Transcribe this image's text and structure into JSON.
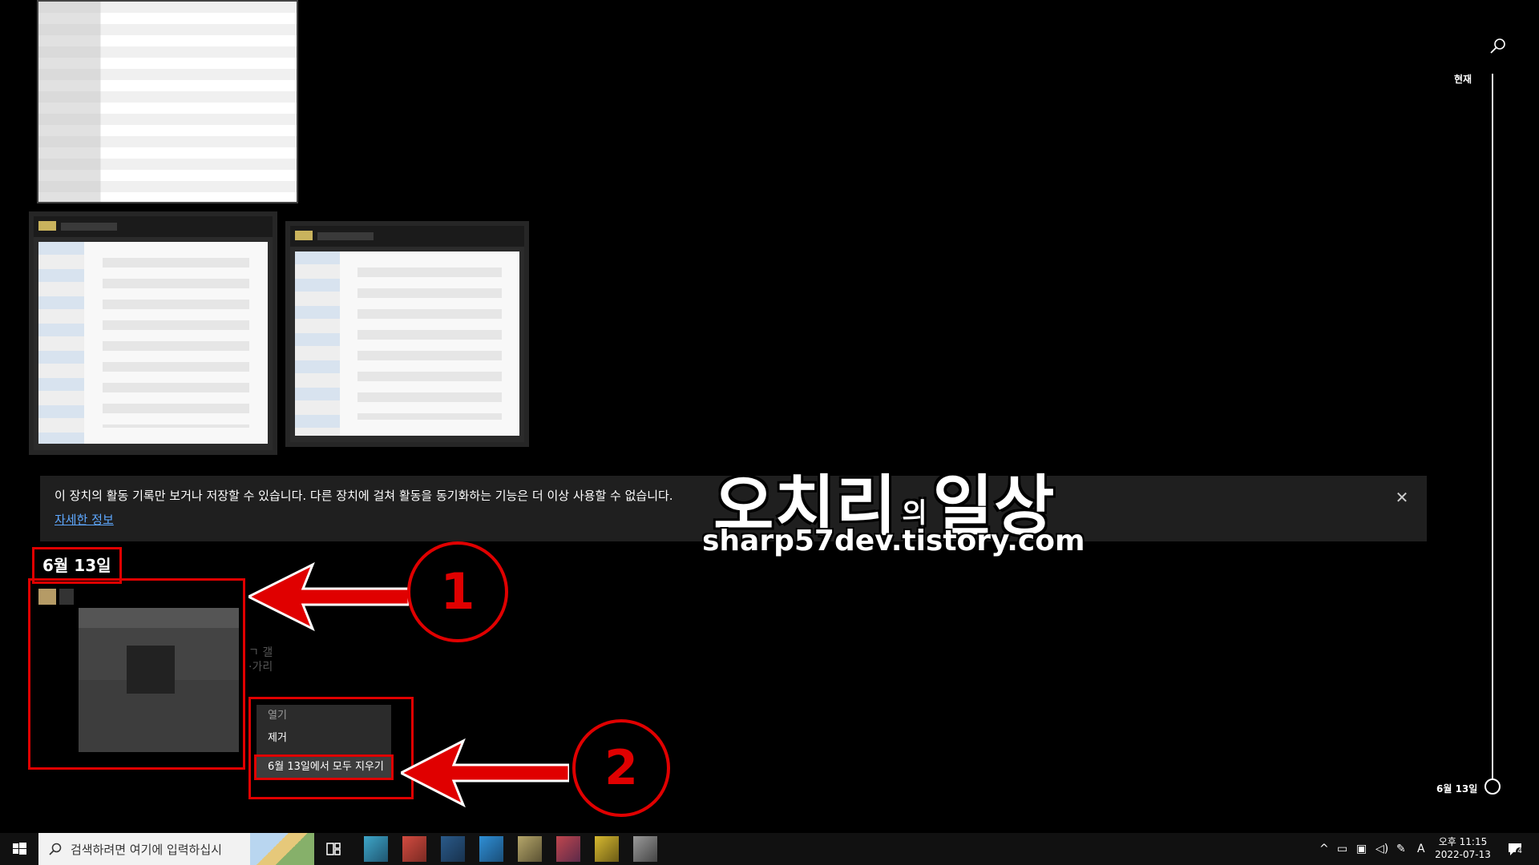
{
  "banner": {
    "message": "이 장치의 활동 기록만 보거나 저장할 수 있습니다. 다른 장치에 걸쳐 활동을 동기화하는 기능은 더 이상 사용할 수 없습니다.",
    "link": "자세한 정보",
    "close_icon": "close-icon"
  },
  "watermark": {
    "main_1": "오치리",
    "small": "의",
    "main_2": "일상",
    "url": "sharp57dev.tistory.com"
  },
  "group": {
    "date": "6월 13일",
    "ghost_line_1": "ㄱ 갤",
    "ghost_line_2": "·가리"
  },
  "context_menu": {
    "open": "열기",
    "remove": "제거",
    "clear_all": "6월 13일에서 모두 지우기"
  },
  "annotations": {
    "one": "1",
    "two": "2"
  },
  "timeline": {
    "top": "현재",
    "bottom": "6월 13일"
  },
  "taskbar": {
    "search_placeholder": "검색하려면 여기에 입력하십시",
    "time": "오후 11:15",
    "date": "2022-07-13",
    "notifications": "4",
    "ime": "A"
  },
  "colors": {
    "annotation": "#e00000",
    "link": "#5ea8ff",
    "banner_bg": "#1f1f1f"
  }
}
